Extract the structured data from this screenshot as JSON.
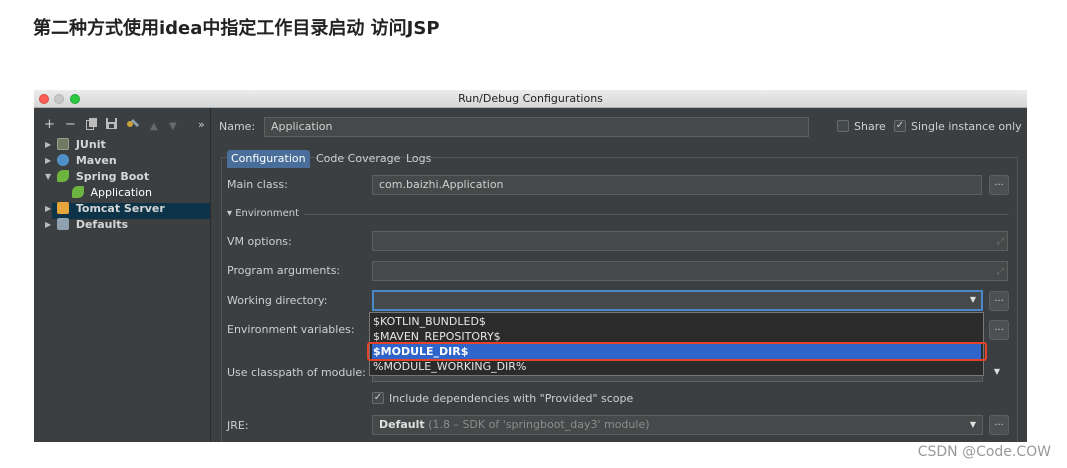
{
  "article": {
    "heading": "第二种方式使用idea中指定工作目录启动 访问JSP"
  },
  "dialog": {
    "title": "Run/Debug Configurations"
  },
  "sidebar": {
    "toolbar": {
      "add": "+",
      "remove": "−",
      "more": "»"
    },
    "tree": [
      {
        "label": "JUnit"
      },
      {
        "label": "Maven"
      },
      {
        "label": "Spring Boot"
      },
      {
        "label": "Application"
      },
      {
        "label": "Tomcat Server"
      },
      {
        "label": "Defaults"
      }
    ]
  },
  "header": {
    "name_label": "Name:",
    "name_value": "Application",
    "share_label": "Share",
    "single_instance_label": "Single instance only",
    "share_checked": false,
    "single_instance_checked": true
  },
  "tabs": [
    "Configuration",
    "Code Coverage",
    "Logs"
  ],
  "form": {
    "main_class_label": "Main class:",
    "main_class_value": "com.baizhi.Application",
    "environment_section": "Environment",
    "vm_options_label": "VM options:",
    "program_arguments_label": "Program arguments:",
    "working_directory_label": "Working directory:",
    "environment_variables_label": "Environment variables:",
    "use_classpath_label": "Use classpath of module:",
    "include_dependencies_label": "Include dependencies with \"Provided\" scope",
    "include_dependencies_checked": true,
    "jre_label": "JRE:",
    "jre_value_bold": "Default",
    "jre_value_detail": "(1.8 – SDK of 'springboot_day3' module)",
    "browse_button": "..."
  },
  "dropdown": {
    "items": [
      "$KOTLIN_BUNDLED$",
      "$MAVEN_REPOSITORY$",
      "$MODULE_DIR$",
      "%MODULE_WORKING_DIR%"
    ],
    "selected_index": 2
  },
  "colors": {
    "dialog_bg": "#3c3f41",
    "field_bg": "#45494a",
    "selection_blue": "#2f65ca",
    "highlight_red": "#e4422b"
  },
  "watermark": "CSDN @Code.COW"
}
